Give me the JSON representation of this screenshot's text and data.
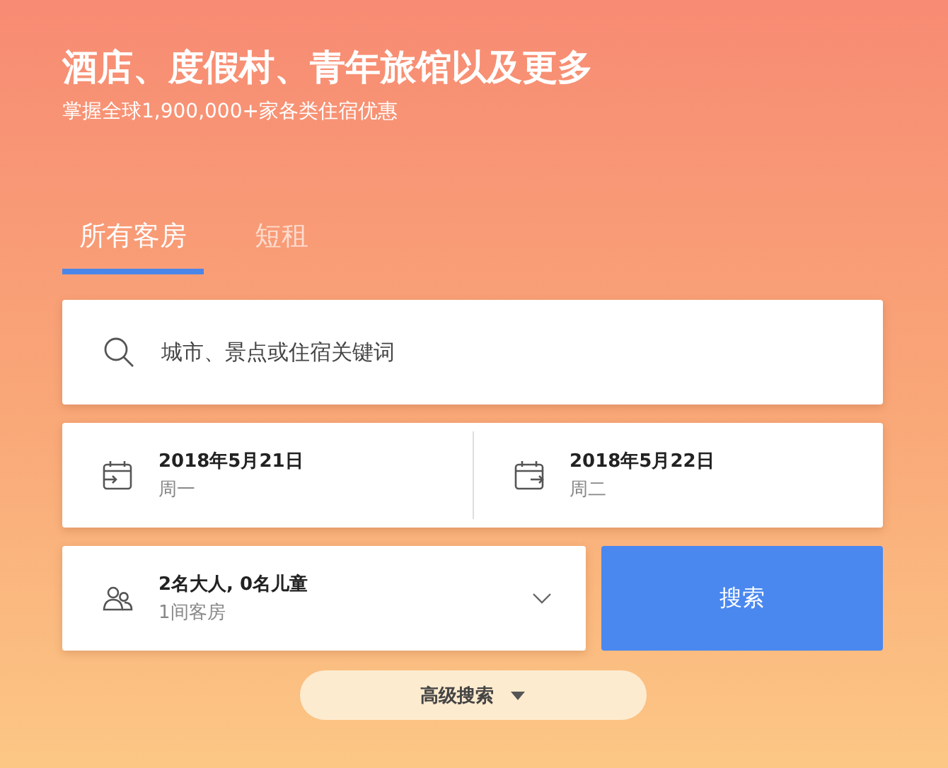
{
  "header": {
    "title": "酒店、度假村、青年旅馆以及更多",
    "subtitle": "掌握全球1,900,000+家各类住宿优惠"
  },
  "tabs": [
    {
      "label": "所有客房",
      "selected": true
    },
    {
      "label": "短租",
      "selected": false
    }
  ],
  "search": {
    "placeholder": "城市、景点或住宿关键词"
  },
  "dates": [
    {
      "kind": "checkin",
      "date": "2018年5月21日",
      "weekday": "周一"
    },
    {
      "kind": "checkout",
      "date": "2018年5月22日",
      "weekday": "周二"
    }
  ],
  "guests": {
    "summary": "2名大人, 0名儿童",
    "rooms": "1间客房"
  },
  "search_button": "搜索",
  "advanced_button": "高级搜索"
}
